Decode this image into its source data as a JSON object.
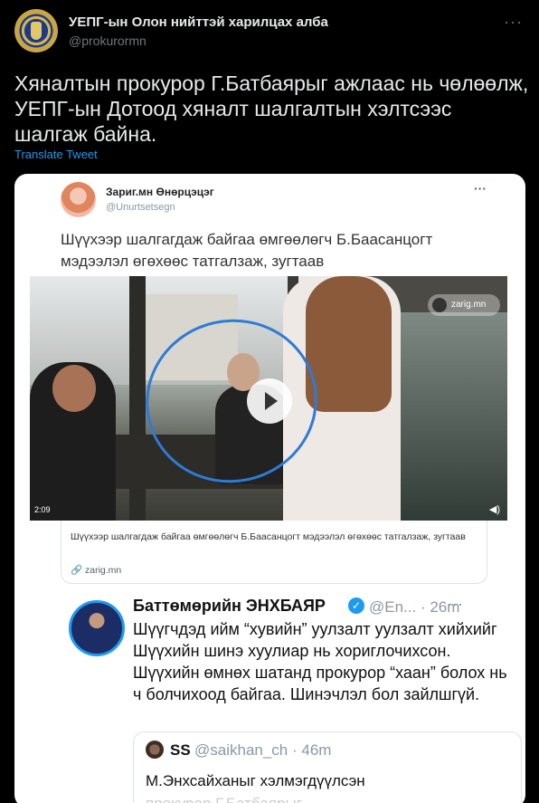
{
  "tweet": {
    "author_name": "УЕПГ-ын Олон нийттэй харилцах алба",
    "author_handle": "@prokurormn",
    "more_icon": "more-dots-icon",
    "text": "Хяналтын прокурор Г.Батбаярыг ажлаас нь чөлөөлж, УЕПГ-ын Дотоод хяналт шалгалтын хэлтсээс шалгаж байна.",
    "translate_label": "Translate Tweet"
  },
  "quoted": {
    "author_name": "Зариг.мн Өнөрцэцэг",
    "author_handle": "@Unurtsetsegn",
    "dots": "···",
    "text": "Шүүхээр шалгагдаж байгаа өмгөөлөгч Б.Баасанцогт мэдээлэл өгөхөөс татгалзаж, зугтаав",
    "video": {
      "duration": "2:09",
      "watermark": "zarig.mn",
      "play_icon": "play-icon",
      "volume_icon": "volume-icon"
    },
    "link": {
      "description": "Шүүхээр шалгагдаж байгаа өмгөөлөгч Б.Баасанцогт мэдээлэл өгөхөөс татгалзаж, зугтаав",
      "domain": "🔗 zarig.mn"
    }
  },
  "reply": {
    "author_name": "Баттөмөрийн ЭНХБАЯР",
    "verified_mark": "✓",
    "handle_time": "@En... · 26m",
    "dots": "···",
    "text": "Шүүгчдэд ийм “хувийн” уулзалт уулзалт хийхийг Шүүхийн шинэ хуулиар нь хориглочихсон. Шүүхийн өмнөх шатанд прокурор “хаан” болох нь ч болчихоод байгаа. Шинэчлэл бол зайлшгүй.",
    "inner": {
      "author_name": "SS",
      "handle_time": "@saikhan_ch · 46m",
      "text": "М.Энхсайханыг хэлмэгдүүлсэн",
      "text_cut": "прокурор Г.Батбаярыг ..."
    }
  }
}
